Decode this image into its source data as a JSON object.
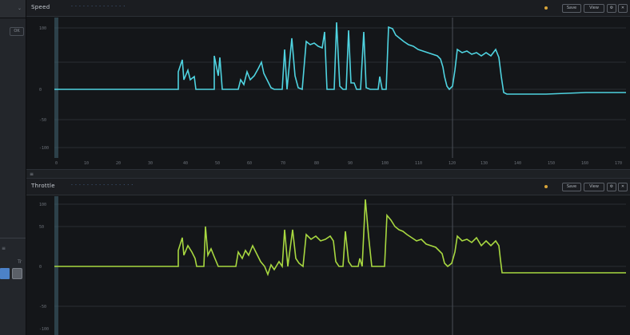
{
  "app": {
    "accent_blue": "#4c82c8",
    "top_trace_color": "#4fd3e0",
    "bottom_trace_color": "#a8d840"
  },
  "sidebar": {
    "top_label": "⌄",
    "chip_label": "OK",
    "bottom_label": "≡",
    "bottom_label2": "Tr"
  },
  "panels": [
    {
      "title": "Speed",
      "subtitle": "· · · · · · · · · · · · · ·",
      "buttons": [
        "Save",
        "View",
        "⚙",
        "✕"
      ]
    },
    {
      "title": "Throttle",
      "subtitle": "· · · · · · · · · · · · · · · ·",
      "buttons": [
        "Save",
        "View",
        "⚙",
        "✕"
      ]
    }
  ],
  "splitter_icon": "≡",
  "x_ticks": [
    "0",
    "10",
    "20",
    "30",
    "40",
    "50",
    "60",
    "70",
    "80",
    "90",
    "100",
    "110",
    "120",
    "130",
    "140",
    "150",
    "160",
    "170",
    "180"
  ],
  "y_ticks_top": [
    "100",
    "",
    "0",
    "-50",
    "-100"
  ],
  "y_ticks_bottom": [
    "100",
    "50",
    "0",
    "-50",
    "-100"
  ]
}
